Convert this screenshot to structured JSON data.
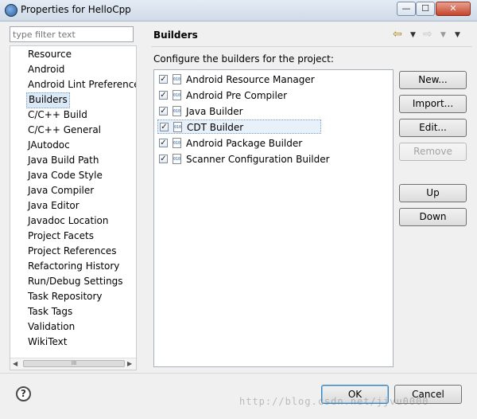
{
  "window": {
    "title": "Properties for HelloCpp",
    "minimize_glyph": "—",
    "maximize_glyph": "☐",
    "close_glyph": "✕"
  },
  "sidebar": {
    "filter_placeholder": "type filter text",
    "items": [
      {
        "label": "Resource"
      },
      {
        "label": "Android"
      },
      {
        "label": "Android Lint Preferences"
      },
      {
        "label": "Builders",
        "selected": true
      },
      {
        "label": "C/C++ Build"
      },
      {
        "label": "C/C++ General"
      },
      {
        "label": "JAutodoc"
      },
      {
        "label": "Java Build Path"
      },
      {
        "label": "Java Code Style"
      },
      {
        "label": "Java Compiler"
      },
      {
        "label": "Java Editor"
      },
      {
        "label": "Javadoc Location"
      },
      {
        "label": "Project Facets"
      },
      {
        "label": "Project References"
      },
      {
        "label": "Refactoring History"
      },
      {
        "label": "Run/Debug Settings"
      },
      {
        "label": "Task Repository"
      },
      {
        "label": "Task Tags"
      },
      {
        "label": "Validation"
      },
      {
        "label": "WikiText"
      }
    ],
    "scroll": {
      "left_glyph": "◀",
      "right_glyph": "▶",
      "thumb_grip": "III"
    }
  },
  "main": {
    "title": "Builders",
    "nav": {
      "back_glyph": "⇦",
      "forward_glyph": "⇨",
      "dropdown_glyph": "▼",
      "menu_glyph": "▼"
    },
    "description": "Configure the builders for the project:",
    "builders": [
      {
        "label": "Android Resource Manager",
        "checked": true,
        "icon": "builder-icon",
        "icon_text": "010"
      },
      {
        "label": "Android Pre Compiler",
        "checked": true,
        "icon": "builder-icon",
        "icon_text": "010"
      },
      {
        "label": "Java Builder",
        "checked": true,
        "icon": "builder-icon",
        "icon_text": "010"
      },
      {
        "label": "CDT Builder",
        "checked": true,
        "icon": "builder-icon",
        "icon_text": "010",
        "selected": true
      },
      {
        "label": "Android Package Builder",
        "checked": true,
        "icon": "builder-icon",
        "icon_text": "010"
      },
      {
        "label": "Scanner Configuration Builder",
        "checked": true,
        "icon": "builder-icon",
        "icon_text": "010"
      }
    ],
    "checkmark_glyph": "✓",
    "buttons": {
      "new": "New...",
      "import": "Import...",
      "edit": "Edit...",
      "remove": "Remove",
      "up": "Up",
      "down": "Down"
    }
  },
  "footer": {
    "help_glyph": "?",
    "ok": "OK",
    "cancel": "Cancel"
  },
  "watermark": "http://blog.csdn.net/jjvu0000"
}
